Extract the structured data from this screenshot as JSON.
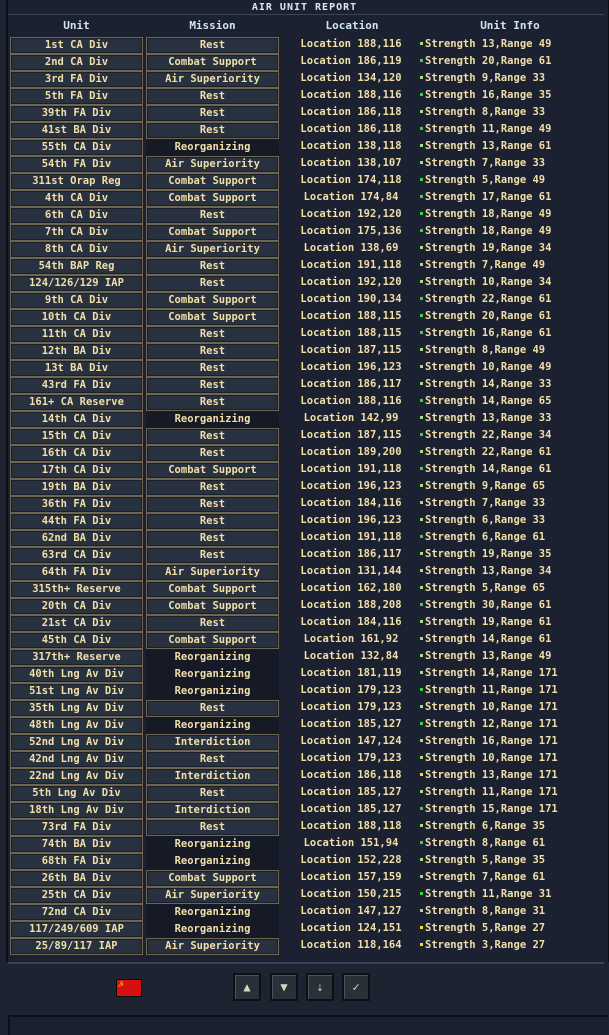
{
  "window": {
    "title": "AIR UNIT REPORT"
  },
  "columns": {
    "unit": "Unit",
    "mission": "Mission",
    "location": "Location",
    "info": "Unit Info"
  },
  "colors": {
    "text": "#f2dfa8",
    "header": "#cfe6f0",
    "dot_green": "#3ad13a",
    "dot_pale": "#9ee07a",
    "dot_yellow": "#f0e020"
  },
  "rows": [
    {
      "unit": "1st CA Div",
      "mission": "Rest",
      "location": "Location 188,116",
      "info": "Strength 13,Range 49",
      "dot": "#9ee07a"
    },
    {
      "unit": "2nd CA Div",
      "mission": "Combat Support",
      "location": "Location 186,119",
      "info": "Strength 20,Range 61",
      "dot": "#3ad13a"
    },
    {
      "unit": "3rd FA Div",
      "mission": "Air Superiority",
      "location": "Location 134,120",
      "info": "Strength 9,Range 33",
      "dot": "#9ee07a"
    },
    {
      "unit": "5th FA Div",
      "mission": "Rest",
      "location": "Location 188,116",
      "info": "Strength 16,Range 35",
      "dot": "#3ad13a"
    },
    {
      "unit": "39th FA Div",
      "mission": "Rest",
      "location": "Location 186,118",
      "info": "Strength 8,Range 33",
      "dot": "#9ee07a"
    },
    {
      "unit": "41st BA Div",
      "mission": "Rest",
      "location": "Location 186,118",
      "info": "Strength 11,Range 49",
      "dot": "#3ad13a"
    },
    {
      "unit": "55th CA Div",
      "mission": "Reorganizing",
      "location": "Location 138,118",
      "info": "Strength 13,Range 61",
      "dot": "#9ee07a"
    },
    {
      "unit": "54th FA Div",
      "mission": "Air Superiority",
      "location": "Location 138,107",
      "info": "Strength 7,Range 33",
      "dot": "#9ee07a"
    },
    {
      "unit": "311st Orap Reg",
      "mission": "Combat Support",
      "location": "Location 174,118",
      "info": "Strength 5,Range 49",
      "dot": "#3ad13a"
    },
    {
      "unit": "4th CA Div",
      "mission": "Combat Support",
      "location": "Location 174,84",
      "info": "Strength 17,Range 61",
      "dot": "#3ad13a"
    },
    {
      "unit": "6th CA Div",
      "mission": "Rest",
      "location": "Location 192,120",
      "info": "Strength 18,Range 49",
      "dot": "#3ad13a"
    },
    {
      "unit": "7th CA Div",
      "mission": "Combat Support",
      "location": "Location 175,136",
      "info": "Strength 18,Range 49",
      "dot": "#3ad13a"
    },
    {
      "unit": "8th CA Div",
      "mission": "Air Superiority",
      "location": "Location 138,69",
      "info": "Strength 19,Range 34",
      "dot": "#9ee07a"
    },
    {
      "unit": "54th BAP Reg",
      "mission": "Rest",
      "location": "Location 191,118",
      "info": "Strength 7,Range 49",
      "dot": "#9ee07a"
    },
    {
      "unit": "124/126/129 IAP",
      "mission": "Rest",
      "location": "Location 192,120",
      "info": "Strength 10,Range 34",
      "dot": "#9ee07a"
    },
    {
      "unit": "9th CA Div",
      "mission": "Combat Support",
      "location": "Location 190,134",
      "info": "Strength 22,Range 61",
      "dot": "#3ad13a"
    },
    {
      "unit": "10th CA Div",
      "mission": "Combat Support",
      "location": "Location 188,115",
      "info": "Strength 20,Range 61",
      "dot": "#3ad13a"
    },
    {
      "unit": "11th CA Div",
      "mission": "Rest",
      "location": "Location 188,115",
      "info": "Strength 16,Range 61",
      "dot": "#3ad13a"
    },
    {
      "unit": "12th BA Div",
      "mission": "Rest",
      "location": "Location 187,115",
      "info": "Strength 8,Range 49",
      "dot": "#9ee07a"
    },
    {
      "unit": "13t BA Div",
      "mission": "Rest",
      "location": "Location 196,123",
      "info": "Strength 10,Range 49",
      "dot": "#9ee07a"
    },
    {
      "unit": "43rd FA Div",
      "mission": "Rest",
      "location": "Location 186,117",
      "info": "Strength 14,Range 33",
      "dot": "#9ee07a"
    },
    {
      "unit": "161+ CA Reserve",
      "mission": "Rest",
      "location": "Location 188,116",
      "info": "Strength 14,Range 65",
      "dot": "#3ad13a"
    },
    {
      "unit": "14th CA Div",
      "mission": "Reorganizing",
      "location": "Location 142,99",
      "info": "Strength 13,Range 33",
      "dot": "#9ee07a"
    },
    {
      "unit": "15th CA Div",
      "mission": "Rest",
      "location": "Location 187,115",
      "info": "Strength 22,Range 34",
      "dot": "#3ad13a"
    },
    {
      "unit": "16th CA Div",
      "mission": "Rest",
      "location": "Location 189,200",
      "info": "Strength 22,Range 61",
      "dot": "#9ee07a"
    },
    {
      "unit": "17th CA Div",
      "mission": "Combat Support",
      "location": "Location 191,118",
      "info": "Strength 14,Range 61",
      "dot": "#3ad13a"
    },
    {
      "unit": "19th BA Div",
      "mission": "Rest",
      "location": "Location 196,123",
      "info": "Strength 9,Range 65",
      "dot": "#9ee07a"
    },
    {
      "unit": "36th FA Div",
      "mission": "Rest",
      "location": "Location 184,116",
      "info": "Strength 7,Range 33",
      "dot": "#9ee07a"
    },
    {
      "unit": "44th FA Div",
      "mission": "Rest",
      "location": "Location 196,123",
      "info": "Strength 6,Range 33",
      "dot": "#9ee07a"
    },
    {
      "unit": "62nd BA Div",
      "mission": "Rest",
      "location": "Location 191,118",
      "info": "Strength 6,Range 61",
      "dot": "#3ad13a"
    },
    {
      "unit": "63rd CA Div",
      "mission": "Rest",
      "location": "Location 186,117",
      "info": "Strength 19,Range 35",
      "dot": "#9ee07a"
    },
    {
      "unit": "64th FA Div",
      "mission": "Air Superiority",
      "location": "Location 131,144",
      "info": "Strength 13,Range 34",
      "dot": "#9ee07a"
    },
    {
      "unit": "315th+ Reserve",
      "mission": "Combat Support",
      "location": "Location 162,180",
      "info": "Strength 5,Range 65",
      "dot": "#9ee07a"
    },
    {
      "unit": "20th CA Div",
      "mission": "Combat Support",
      "location": "Location 188,208",
      "info": "Strength 30,Range 61",
      "dot": "#3ad13a"
    },
    {
      "unit": "21st CA Div",
      "mission": "Rest",
      "location": "Location 184,116",
      "info": "Strength 19,Range 61",
      "dot": "#9ee07a"
    },
    {
      "unit": "45th CA Div",
      "mission": "Combat Support",
      "location": "Location 161,92",
      "info": "Strength 14,Range 61",
      "dot": "#9ee07a"
    },
    {
      "unit": "317th+ Reserve",
      "mission": "Reorganizing",
      "location": "Location 132,84",
      "info": "Strength 13,Range 49",
      "dot": "#9ee07a"
    },
    {
      "unit": "40th Lng Av Div",
      "mission": "Reorganizing",
      "location": "Location 181,119",
      "info": "Strength 14,Range 171",
      "dot": "#9ee07a"
    },
    {
      "unit": "51st Lng Av Div",
      "mission": "Reorganizing",
      "location": "Location 179,123",
      "info": "Strength 11,Range 171",
      "dot": "#3ad13a"
    },
    {
      "unit": "35th Lng Av Div",
      "mission": "Rest",
      "location": "Location 179,123",
      "info": "Strength 10,Range 171",
      "dot": "#9ee07a"
    },
    {
      "unit": "48th Lng Av Div",
      "mission": "Reorganizing",
      "location": "Location 185,127",
      "info": "Strength 12,Range 171",
      "dot": "#3ad13a"
    },
    {
      "unit": "52nd Lng Av Div",
      "mission": "Interdiction",
      "location": "Location 147,124",
      "info": "Strength 16,Range 171",
      "dot": "#9ee07a"
    },
    {
      "unit": "42nd Lng Av Div",
      "mission": "Rest",
      "location": "Location 179,123",
      "info": "Strength 10,Range 171",
      "dot": "#9ee07a"
    },
    {
      "unit": "22nd Lng Av Div",
      "mission": "Interdiction",
      "location": "Location 186,118",
      "info": "Strength 13,Range 171",
      "dot": "#f0e020"
    },
    {
      "unit": "5th Lng Av Div",
      "mission": "Rest",
      "location": "Location 185,127",
      "info": "Strength 11,Range 171",
      "dot": "#9ee07a"
    },
    {
      "unit": "18th Lng Av Div",
      "mission": "Interdiction",
      "location": "Location 185,127",
      "info": "Strength 15,Range 171",
      "dot": "#3ad13a"
    },
    {
      "unit": "73rd FA Div",
      "mission": "Rest",
      "location": "Location 188,118",
      "info": "Strength 6,Range 35",
      "dot": "#9ee07a"
    },
    {
      "unit": "74th BA Div",
      "mission": "Reorganizing",
      "location": "Location 151,94",
      "info": "Strength 8,Range 61",
      "dot": "#3ad13a"
    },
    {
      "unit": "68th FA Div",
      "mission": "Reorganizing",
      "location": "Location 152,228",
      "info": "Strength 5,Range 35",
      "dot": "#9ee07a"
    },
    {
      "unit": "26th BA Div",
      "mission": "Combat Support",
      "location": "Location 157,159",
      "info": "Strength 7,Range 61",
      "dot": "#9ee07a"
    },
    {
      "unit": "25th CA Div",
      "mission": "Air Superiority",
      "location": "Location 150,215",
      "info": "Strength 11,Range 31",
      "dot": "#3ad13a"
    },
    {
      "unit": "72nd CA Div",
      "mission": "Reorganizing",
      "location": "Location 147,127",
      "info": "Strength 8,Range 31",
      "dot": "#9ee07a"
    },
    {
      "unit": "117/249/609 IAP",
      "mission": "Reorganizing",
      "location": "Location 124,151",
      "info": "Strength 5,Range 27",
      "dot": "#f0e020"
    },
    {
      "unit": "25/89/117 IAP",
      "mission": "Air Superiority",
      "location": "Location 118,164",
      "info": "Strength 3,Range 27",
      "dot": "#f0e020"
    }
  ],
  "toolbar": {
    "flag_icon": "soviet-flag-icon",
    "buttons": [
      {
        "icon": "scroll-up-icon",
        "glyph": "▲"
      },
      {
        "icon": "scroll-down-icon",
        "glyph": "▼"
      },
      {
        "icon": "sort-icon",
        "glyph": "⇣"
      },
      {
        "icon": "checkmark-icon",
        "glyph": "✓"
      }
    ]
  }
}
